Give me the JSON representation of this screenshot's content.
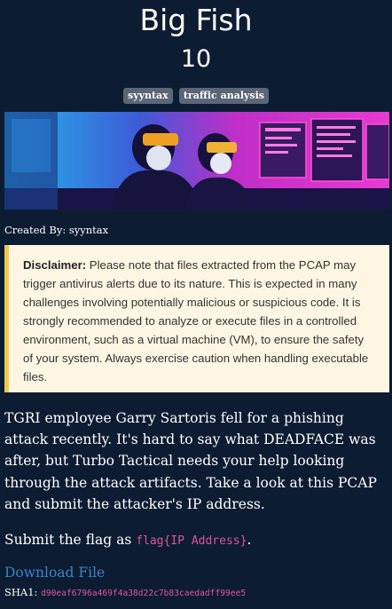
{
  "challenge": {
    "title": "Big Fish",
    "points": "10",
    "tags": [
      "syyntax",
      "traffic analysis"
    ],
    "created_by": "Created By: syyntax"
  },
  "disclaimer": {
    "label": "Disclaimer:",
    "text": " Please note that files extracted from the PCAP may trigger antivirus alerts due to its nature. This is expected in many challenges involving potentially malicious or suspicious code. It is strongly recommended to analyze or execute files in a controlled environment, such as a virtual machine (VM), to ensure the safety of your system. Always exercise caution when handling executable files."
  },
  "description": "TGRI employee Garry Sartoris fell for a phishing attack recently. It's hard to say what DEADFACE was after, but Turbo Tactical needs your help looking through the attack artifacts. Take a look at this PCAP and submit the attacker's IP address.",
  "submit": {
    "prefix": "Submit the flag as ",
    "flag_format": "flag{IP Address}",
    "suffix": "."
  },
  "download": {
    "label": "Download File"
  },
  "sha1": {
    "label": "SHA1:",
    "value": "d90eaf6796a469f4a38d22c7b83caedadff99ee5"
  },
  "colors": {
    "background": "#0c1d33",
    "tag_bg": "#5b6677",
    "disclaimer_bg": "#fdf6e3",
    "disclaimer_border": "#f2c94c",
    "link": "#3f82c4",
    "code": "#e0559a"
  }
}
